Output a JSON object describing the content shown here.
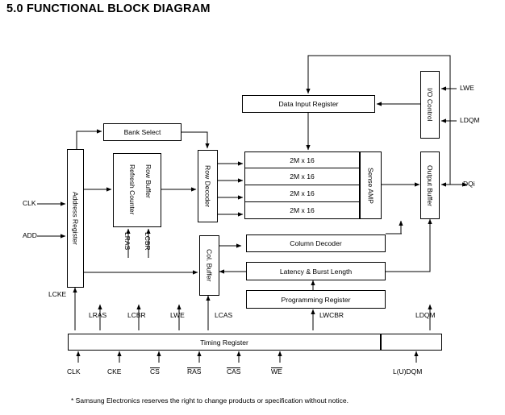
{
  "page": {
    "title": "5.0 FUNCTIONAL BLOCK DIAGRAM",
    "footnote": "* Samsung Electronics reserves the right to change products or specification without notice."
  },
  "blocks": {
    "address_register": "Address Register",
    "bank_select": "Bank Select",
    "row_buffer": "Row Buffer",
    "refresh_counter": "Refresh Counter",
    "row_decoder": "Row Decoder",
    "col_buffer": "Col. Buffer",
    "data_input_register": "Data Input Register",
    "sense_amp": "Sense AMP",
    "io_control": "I/O Control",
    "output_buffer": "Output Buffer",
    "column_decoder": "Column Decoder",
    "latency_burst": "Latency & Burst Length",
    "programming_register": "Programming Register",
    "timing_register": "Timing Register",
    "memory_banks": [
      "2M x 16",
      "2M x 16",
      "2M x 16",
      "2M x 16"
    ]
  },
  "signals": {
    "left_inputs": [
      {
        "label": "CLK"
      },
      {
        "label": "ADD"
      }
    ],
    "right_outputs": [
      {
        "label": "LWE"
      },
      {
        "label": "LDQM"
      },
      {
        "label": "DQi"
      }
    ],
    "internal": [
      {
        "label": "LCKE"
      },
      {
        "label": "LRAS"
      },
      {
        "label": "LCBR"
      },
      {
        "label": "LRAS"
      },
      {
        "label": "LCBR"
      },
      {
        "label": "LWE"
      },
      {
        "label": "LCAS"
      },
      {
        "label": "LWCBR"
      },
      {
        "label": "LDQM"
      }
    ],
    "bottom_inputs": [
      {
        "label": "CLK",
        "overline": false
      },
      {
        "label": "CKE",
        "overline": false
      },
      {
        "label": "CS",
        "overline": true
      },
      {
        "label": "RAS",
        "overline": true
      },
      {
        "label": "CAS",
        "overline": true
      },
      {
        "label": "WE",
        "overline": true
      },
      {
        "label": "L(U)DQM",
        "overline": false
      }
    ]
  }
}
